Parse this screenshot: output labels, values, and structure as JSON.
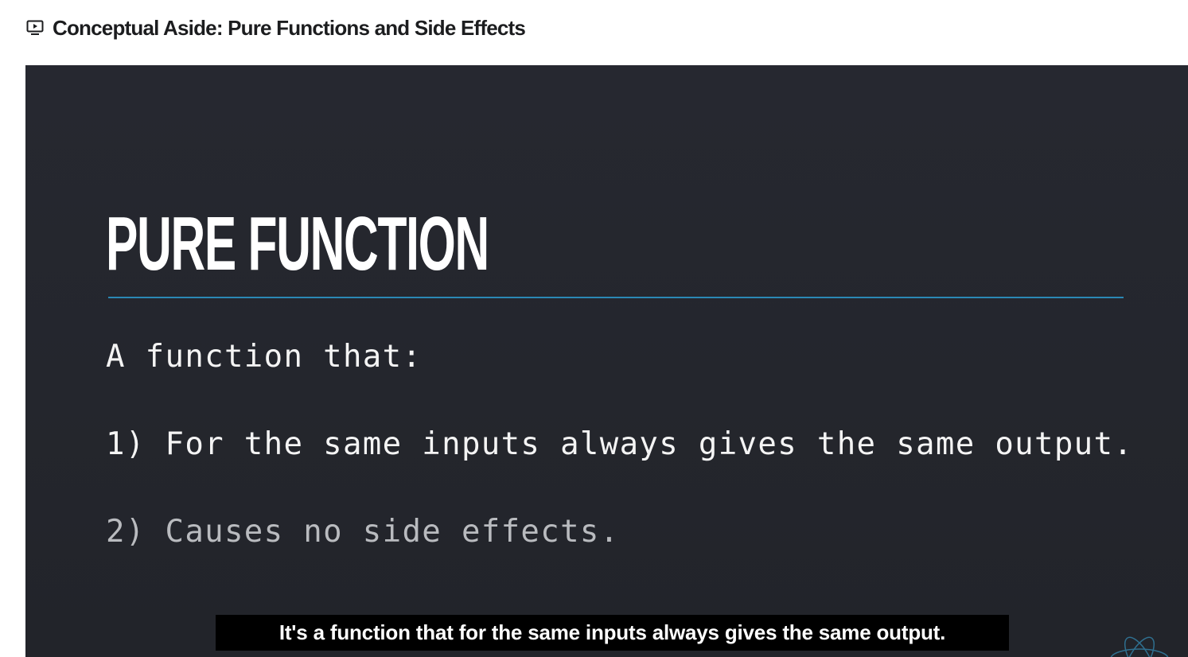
{
  "header": {
    "icon": "play-video-icon",
    "lecture_title": "Conceptual Aside: Pure Functions and Side Effects"
  },
  "slide": {
    "heading": "PURE FUNCTION",
    "intro": "A function that:",
    "point1": "1) For the same inputs always gives the same output.",
    "point2": "2) Causes no side effects."
  },
  "caption": {
    "text": "It's a function that for the same inputs always gives the same output."
  },
  "colors": {
    "slide_background": "#25272e",
    "accent_rule": "#2a88b5",
    "title_text": "#1c1d1f"
  }
}
